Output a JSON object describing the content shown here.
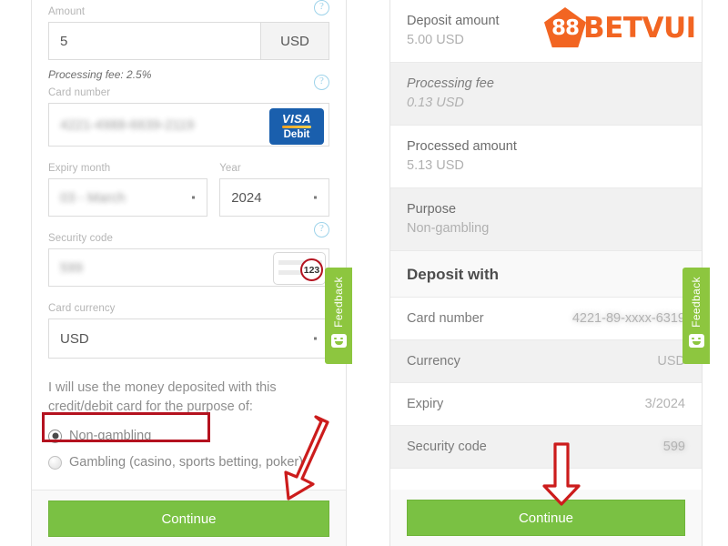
{
  "form": {
    "amount": {
      "label": "Amount",
      "value": "5",
      "currency_suffix": "USD",
      "help": "?"
    },
    "processing_fee_note": "Processing fee: 2.5%",
    "card_number": {
      "label": "Card number",
      "value": "4221-4988-6639-2119",
      "help": "?",
      "brand_primary": "VISA",
      "brand_secondary": "Debit"
    },
    "expiry_month": {
      "label": "Expiry month",
      "value": "03 - March"
    },
    "year": {
      "label": "Year",
      "value": "2024"
    },
    "security_code": {
      "label": "Security code",
      "value": "599",
      "help": "?",
      "hint_badge": "123"
    },
    "card_currency": {
      "label": "Card currency",
      "value": "USD"
    },
    "purpose_question": "I will use the money deposited with this credit/debit card for the purpose of:",
    "options": [
      {
        "label": "Non-gambling",
        "selected": true
      },
      {
        "label": "Gambling (casino, sports betting, poker)",
        "selected": false
      }
    ],
    "continue_label": "Continue"
  },
  "summary": {
    "rows": [
      {
        "title": "Deposit amount",
        "value": "5.00 USD",
        "italic": false,
        "alt": false
      },
      {
        "title": "Processing fee",
        "value": "0.13 USD",
        "italic": true,
        "alt": true
      },
      {
        "title": "Processed amount",
        "value": "5.13 USD",
        "italic": false,
        "alt": false
      },
      {
        "title": "Purpose",
        "value": "Non-gambling",
        "italic": false,
        "alt": true
      }
    ],
    "section_heading": "Deposit with",
    "details": [
      {
        "key": "Card number",
        "value": "4221-89-xxxx-6319",
        "alt": false,
        "blurred": true
      },
      {
        "key": "Currency",
        "value": "USD",
        "alt": true,
        "blurred": false
      },
      {
        "key": "Expiry",
        "value": "3/2024",
        "alt": false,
        "blurred": false
      },
      {
        "key": "Security code",
        "value": "599",
        "alt": true,
        "blurred": true
      }
    ],
    "continue_label": "Continue"
  },
  "logo": {
    "mark": "88",
    "word": "BETVUI"
  },
  "feedback": {
    "label": "Feedback"
  },
  "colors": {
    "brand_orange": "#f26522",
    "continue_green": "#7ac143",
    "feedback_green": "#8dc63f",
    "annotation_red": "#b4121f",
    "visa_blue": "#1a5fad"
  }
}
